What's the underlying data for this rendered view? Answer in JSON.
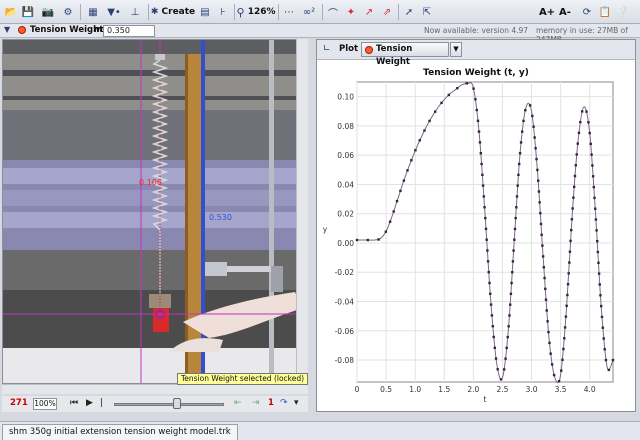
{
  "toolbar": {
    "create_label": "Create",
    "zoom_label": "126%",
    "font_bigger": "A+",
    "font_smaller": "A-"
  },
  "track": {
    "name": "Tension Weight",
    "mass_label": "m",
    "mass_value": "0.350"
  },
  "notice": {
    "version": "Now available: version 4.97",
    "memory": "memory in use: 27MB of 247MB"
  },
  "video": {
    "overlay_label_y": "0.106",
    "overlay_label_x": "0.530",
    "status_tooltip": "Tension Weight selected (locked)"
  },
  "player": {
    "frame": "271",
    "zoom": "100%",
    "end_marker": "1"
  },
  "plot": {
    "tab_label": "Plot",
    "track_button": "Tension Weight"
  },
  "file_tab": "shm 350g initial extension tension weight model.trk",
  "colors": {
    "accent": "#2b3f76",
    "track_marker": "#ff5a30",
    "data_point": "#3a1e4a",
    "curve": "#7a6a7a"
  },
  "chart_data": {
    "type": "line",
    "title": "Tension Weight (t, y)",
    "xlabel": "t",
    "ylabel": "y",
    "xlim": [
      0,
      4.4
    ],
    "ylim": [
      -0.095,
      0.11
    ],
    "xticks": [
      0,
      0.5,
      1,
      1.5,
      2,
      2.5,
      3,
      3.5,
      4
    ],
    "xtick_labels": [
      "0",
      "0.5",
      "1.0",
      "1.5",
      "2.0",
      "2.5",
      "3.0",
      "3.5",
      "4.0"
    ],
    "yticks": [
      0.1,
      0.08,
      0.06,
      0.04,
      0.02,
      0,
      -0.02,
      -0.04,
      -0.06,
      -0.08
    ],
    "ytick_labels": [
      "0.10",
      "0.08",
      "0.06",
      "0.04",
      "0.02",
      "0.00",
      "-0.02",
      "-0.04",
      "-0.06",
      "-0.08"
    ],
    "grid": true,
    "series": [
      {
        "x": [
          0,
          0.1,
          0.2,
          0.3,
          0.4,
          0.5,
          0.6,
          0.7,
          0.8,
          0.9,
          1.0,
          1.1,
          1.2,
          1.3,
          1.4,
          1.5,
          1.6,
          1.7,
          1.8,
          1.9,
          2.0,
          2.1,
          2.2,
          2.3,
          2.4,
          2.5,
          2.6,
          2.7,
          2.8,
          2.9,
          3.0,
          3.1,
          3.2,
          3.3,
          3.4,
          3.5,
          3.6,
          3.7,
          3.8,
          3.9,
          4.0,
          4.1,
          4.2,
          4.3,
          4.4
        ],
        "y": [
          0.002,
          0.002,
          0.002,
          0.002,
          0.003,
          0.008,
          0.018,
          0.03,
          0.042,
          0.053,
          0.063,
          0.072,
          0.08,
          0.087,
          0.093,
          0.098,
          0.102,
          0.105,
          0.108,
          0.109,
          0.106,
          0.075,
          0.02,
          -0.04,
          -0.082,
          -0.092,
          -0.06,
          0.0,
          0.06,
          0.092,
          0.09,
          0.05,
          -0.01,
          -0.065,
          -0.092,
          -0.09,
          -0.045,
          0.02,
          0.07,
          0.093,
          0.075,
          0.02,
          -0.045,
          -0.085,
          -0.08
        ]
      }
    ]
  }
}
